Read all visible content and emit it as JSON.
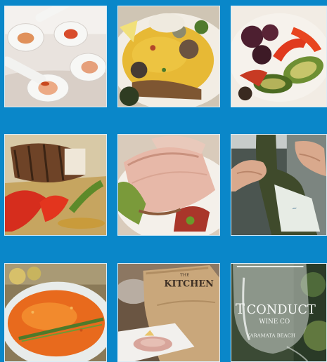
{
  "gallery": {
    "background_color": "#0a87c9",
    "tiles": [
      {
        "id": "tile-1",
        "subject": "spoon-appetizers"
      },
      {
        "id": "tile-2",
        "subject": "saffron-rice-dish"
      },
      {
        "id": "tile-3",
        "subject": "roasted-vegetables"
      },
      {
        "id": "tile-4",
        "subject": "grilled-fish"
      },
      {
        "id": "tile-5",
        "subject": "seared-tuna"
      },
      {
        "id": "tile-6",
        "subject": "wine-bottle"
      },
      {
        "id": "tile-7",
        "subject": "soup-bowl"
      },
      {
        "id": "tile-8",
        "subject": "kitchen-bag"
      },
      {
        "id": "tile-9",
        "subject": "wine-glass"
      }
    ],
    "bag_text": {
      "line1": "THE",
      "line2": "KITCHEN"
    },
    "glass_text": {
      "brand_prefix": "T",
      "brand": "CONDUCT",
      "sub": "WINE CO",
      "location": "KARAMATA BEACH"
    }
  }
}
